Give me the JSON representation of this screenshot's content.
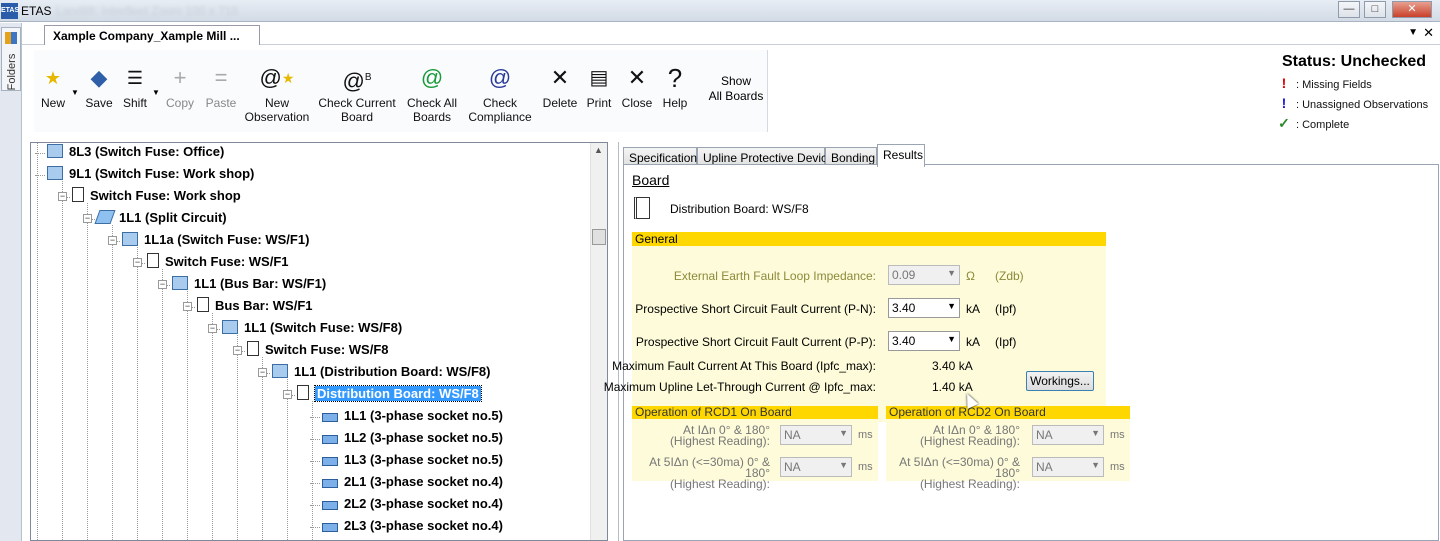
{
  "window": {
    "app_icon_label": "ETAS",
    "title": "ETAS",
    "title_blurred": "Landlift: Interfleet Zoom 100 x 718",
    "controls": [
      "—",
      "□",
      "✕"
    ]
  },
  "folders": {
    "label": "Folders"
  },
  "document_tab": {
    "label": "Xample Company_Xample Mill ...",
    "menu_arrow": "▼",
    "close": "✕"
  },
  "toolbar": {
    "new": "New",
    "save": "Save",
    "shift": "Shift",
    "copy": "Copy",
    "paste": "Paste",
    "new_observation": [
      "New",
      "Observation"
    ],
    "check_current_board": [
      "Check Current",
      "Board"
    ],
    "check_all_boards": [
      "Check All",
      "Boards"
    ],
    "check_compliance": [
      "Check",
      "Compliance"
    ],
    "delete": "Delete",
    "print": "Print",
    "close": "Close",
    "help": "Help",
    "show_all_boards": [
      "Show",
      "All Boards"
    ]
  },
  "status": {
    "title": "Status: Unchecked",
    "legend": [
      {
        "mark": "!",
        "color": "#e00000",
        "text": ": Missing Fields"
      },
      {
        "mark": "!",
        "color": "#1a1ad0",
        "text": ": Unassigned Observations"
      },
      {
        "mark": "✓",
        "color": "#2a8a2a",
        "text": ": Complete"
      }
    ]
  },
  "tree": {
    "nodes": [
      {
        "label": "8L3 (Switch Fuse: Office)"
      },
      {
        "label": "9L1 (Switch Fuse: Work shop)"
      },
      {
        "label": "Switch Fuse: Work shop"
      },
      {
        "label": "1L1 (Split Circuit)"
      },
      {
        "label": "1L1a (Switch Fuse: WS/F1)"
      },
      {
        "label": "Switch Fuse: WS/F1"
      },
      {
        "label": "1L1 (Bus Bar: WS/F1)"
      },
      {
        "label": "Bus Bar: WS/F1"
      },
      {
        "label": "1L1 (Switch Fuse: WS/F8)"
      },
      {
        "label": "Switch Fuse: WS/F8"
      },
      {
        "label": "1L1 (Distribution Board: WS/F8)"
      },
      {
        "label": "Distribution Board: WS/F8"
      },
      {
        "label": "1L1 (3-phase socket no.5)"
      },
      {
        "label": "1L2 (3-phase socket no.5)"
      },
      {
        "label": "1L3 (3-phase socket no.5)"
      },
      {
        "label": "2L1 (3-phase socket no.4)"
      },
      {
        "label": "2L2 (3-phase socket no.4)"
      },
      {
        "label": "2L3 (3-phase socket no.4)"
      }
    ],
    "expander_symbol": "−"
  },
  "tabs": [
    {
      "label": "Specification"
    },
    {
      "label": "Upline Protective Device"
    },
    {
      "label": "Bonding"
    },
    {
      "label": "Results",
      "active": true
    }
  ],
  "results": {
    "heading": "Board",
    "board_label": "Distribution Board: WS/F8",
    "general": {
      "title": "General",
      "external_earth": {
        "label": "External Earth Fault Loop Impedance:",
        "value": "0.09",
        "unit": "Ω",
        "note": "(Zdb)"
      },
      "pscc_pn": {
        "label": "Prospective Short Circuit Fault Current (P-N):",
        "value": "3.40",
        "unit": "kA",
        "note": "(Ipf)"
      },
      "pscc_pp": {
        "label": "Prospective Short Circuit Fault Current (P-P):",
        "value": "3.40",
        "unit": "kA",
        "note": "(Ipf)"
      },
      "max_fault": {
        "label": "Maximum Fault Current At This Board (Ipfc_max):",
        "value": "3.40 kA"
      },
      "max_letthrough": {
        "label": "Maximum Upline Let-Through Current @ Ipfc_max:",
        "value": "1.40 kA"
      },
      "workings_button": "Workings..."
    },
    "rcd1": {
      "title": "Operation of RCD1 On Board",
      "row1_label": [
        "At IΔn 0° & 180°",
        "(Highest Reading):"
      ],
      "row1_value": "NA",
      "row2_label": [
        "At 5IΔn (<=30ma) 0° & 180°",
        "(Highest Reading):"
      ],
      "row2_value": "NA",
      "unit": "ms"
    },
    "rcd2": {
      "title": "Operation of RCD2 On Board",
      "row1_label": [
        "At IΔn 0° & 180°",
        "(Highest Reading):"
      ],
      "row1_value": "NA",
      "row2_label": [
        "At 5IΔn (<=30ma) 0° & 180°",
        "(Highest Reading):"
      ],
      "row2_value": "NA",
      "unit": "ms"
    }
  },
  "icons": {
    "new": "star-icon",
    "save": "save-icon",
    "shift": "shift-icon",
    "copy": "plus-icon",
    "paste": "equals-icon",
    "new_observation": "spiral-star-icon",
    "check_current_board": "spiral-b-icon",
    "check_all_boards": "spiral-green-icon",
    "check_compliance": "spiral-blue-icon",
    "delete": "x-icon",
    "print": "printer-icon",
    "close": "x-icon",
    "help": "question-icon"
  }
}
